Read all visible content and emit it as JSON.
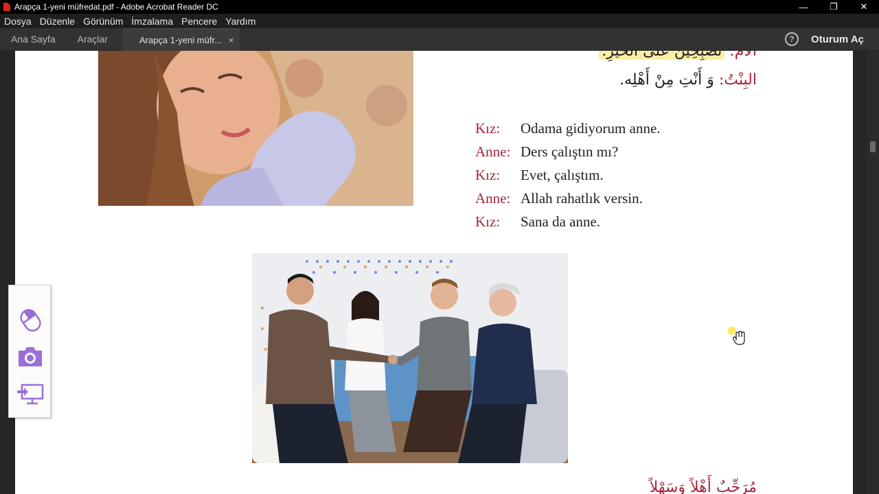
{
  "titlebar": {
    "title": "Arapça 1-yeni müfredat.pdf - Adobe Acrobat Reader DC"
  },
  "menu": {
    "items": [
      "Dosya",
      "Düzenle",
      "Görünüm",
      "İmzalama",
      "Pencere",
      "Yardım"
    ]
  },
  "tabs": {
    "home": "Ana Sayfa",
    "tools": "Araçlar",
    "document": "Arapça 1-yeni müfr...",
    "close": "×"
  },
  "header": {
    "help": "?",
    "signin": "Oturum Aç"
  },
  "page": {
    "arabic_top": {
      "speaker": "الأم:",
      "text": "تُصْبِحِينَ عَلَى الخَيْرِ."
    },
    "arabic_line2": {
      "speaker": "البِنْتُ:",
      "text": "وَ أَنْتِ مِنْ أَهْلِه."
    },
    "dialogue": [
      {
        "speaker": "Kız:",
        "text": "Odama gidiyorum anne."
      },
      {
        "speaker": "Anne:",
        "text": "Ders çalıştın mı?"
      },
      {
        "speaker": "Kız:",
        "text": "Evet, çalıştım."
      },
      {
        "speaker": "Anne:",
        "text": "Allah rahatlık versin."
      },
      {
        "speaker": "Kız:",
        "text": "Sana da anne."
      }
    ],
    "arabic_bottom": "مُرَحِّبٌ أَهْلاً وَسَهْلاً"
  },
  "icons": {
    "pdf": "pdf-file-icon",
    "minimize": "minimize-icon",
    "restore": "restore-icon",
    "close": "close-icon",
    "help": "help-icon",
    "mouse": "mouse-icon",
    "camera": "camera-icon",
    "screen": "screen-share-icon",
    "hand_cursor": "hand-cursor-icon"
  },
  "colors": {
    "accent_tools": "#9b6fd6",
    "speaker": "#a3263a",
    "highlight": "#fbeea4"
  }
}
